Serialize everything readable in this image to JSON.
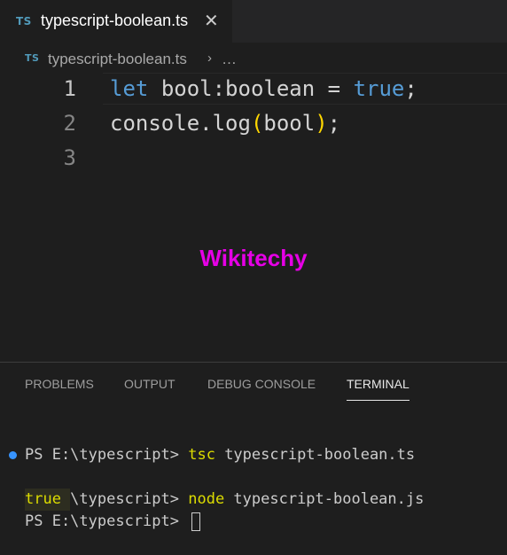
{
  "tab": {
    "icon": "TS",
    "label": "typescript-boolean.ts",
    "close": "✕"
  },
  "breadcrumb": {
    "icon": "TS",
    "file": "typescript-boolean.ts",
    "sep": "›",
    "more": "…"
  },
  "editor": {
    "lines": [
      {
        "num": "1",
        "kw": "let",
        "sp1": " ",
        "ident": "bool:boolean",
        "op": " = ",
        "val": "true",
        "end": ";"
      },
      {
        "num": "2",
        "obj": "console.log",
        "open": "(",
        "arg": "bool",
        "close": ")",
        "end": ";"
      },
      {
        "num": "3"
      }
    ]
  },
  "watermark": "Wikitechy",
  "panel": {
    "tabs": [
      "PROBLEMS",
      "OUTPUT",
      "DEBUG CONSOLE",
      "TERMINAL"
    ],
    "active_tab": "TERMINAL"
  },
  "terminal": {
    "lines": [
      {
        "prompt": "PS E:\\typescript> ",
        "cmd": "tsc",
        "args": " typescript-boolean.ts"
      },
      {
        "prompt": "PS E:\\typescript> ",
        "cmd": "node",
        "args": " typescript-boolean.js"
      },
      {
        "output": "true"
      },
      {
        "prompt": "PS E:\\typescript> "
      }
    ]
  },
  "colors": {
    "keyword": "#569cd6",
    "variable": "#9cdcfe",
    "bracket": "#ffd700",
    "watermark": "#e600e6",
    "terminal_cmd": "#dcdc00"
  }
}
